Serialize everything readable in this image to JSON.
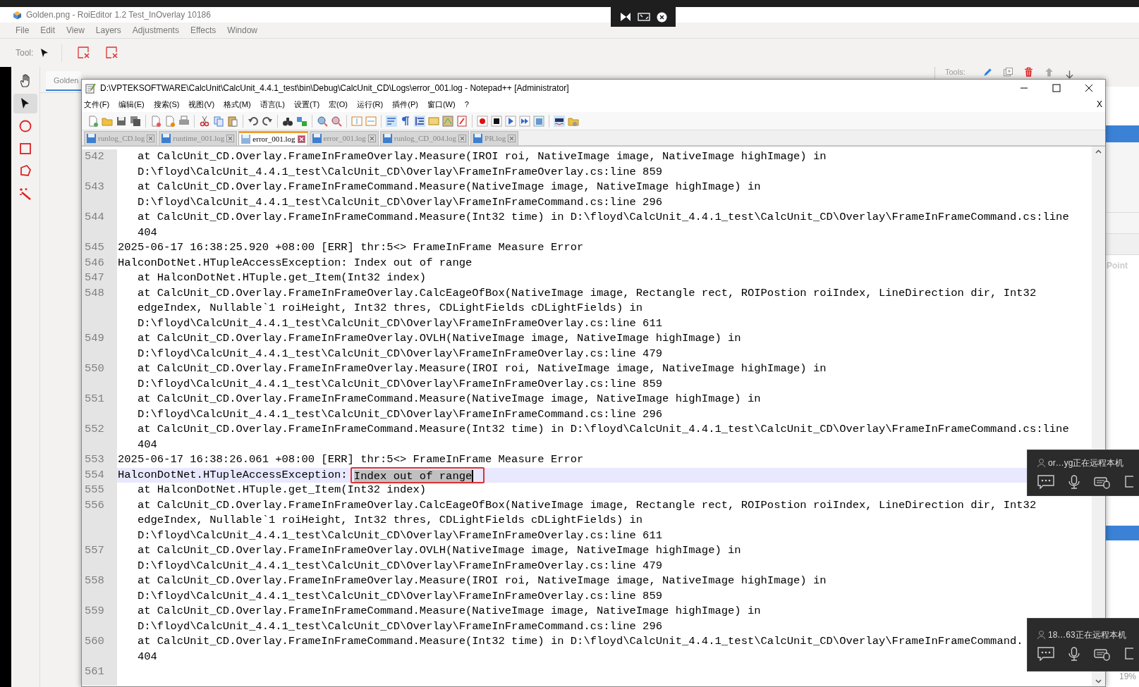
{
  "app": {
    "title": "Golden.png - RoiEditor 1.2 Test_InOverlay 10186",
    "menu": [
      "File",
      "Edit",
      "View",
      "Layers",
      "Adjustments",
      "Effects",
      "Window"
    ],
    "tool_label": "Tool:",
    "tools": [
      {
        "kind": "hand",
        "selected": false
      },
      {
        "kind": "arrow",
        "selected": true
      },
      {
        "kind": "circle",
        "selected": false
      },
      {
        "kind": "rectangle",
        "selected": false
      },
      {
        "kind": "polygon",
        "selected": false
      },
      {
        "kind": "wand",
        "selected": false
      }
    ],
    "document_tab": "Golden",
    "tools_label": "Tools:",
    "point_label": "Point",
    "zoom": "19%"
  },
  "notepad": {
    "title": "D:\\VPTEKSOFTWARE\\CalcUnit\\CalcUnit_4.4.1_test\\bin\\Debug\\CalcUnit_CD\\Logs\\error_001.log - Notepad++ [Administrator]",
    "menu": [
      "文件(F)",
      "编辑(E)",
      "搜索(S)",
      "视图(V)",
      "格式(M)",
      "语言(L)",
      "设置(T)",
      "宏(O)",
      "运行(R)",
      "插件(P)",
      "窗口(W)",
      "?"
    ],
    "close_label": "X",
    "tabs": [
      {
        "label": "runlog_CD.log",
        "selected": false
      },
      {
        "label": "runtime_001.log",
        "selected": false
      },
      {
        "label": "error_001.log",
        "selected": true
      },
      {
        "label": "error_001.log",
        "selected": false
      },
      {
        "label": "runlog_CD_004.log",
        "selected": false
      },
      {
        "label": "PR.log",
        "selected": false
      }
    ],
    "lines": [
      {
        "number": "542",
        "current": false,
        "rows": [
          "   at CalcUnit_CD.Overlay.FrameInFrameOverlay.Measure(IROI roi, NativeImage image, NativeImage highImage) in",
          "   D:\\floyd\\CalcUnit_4.4.1_test\\CalcUnit_CD\\Overlay\\FrameInFrameOverlay.cs:line 859"
        ]
      },
      {
        "number": "543",
        "current": false,
        "rows": [
          "   at CalcUnit_CD.Overlay.FrameInFrameCommand.Measure(NativeImage image, NativeImage highImage) in",
          "   D:\\floyd\\CalcUnit_4.4.1_test\\CalcUnit_CD\\Overlay\\FrameInFrameCommand.cs:line 296"
        ]
      },
      {
        "number": "544",
        "current": false,
        "rows": [
          "   at CalcUnit_CD.Overlay.FrameInFrameCommand.Measure(Int32 time) in D:\\floyd\\CalcUnit_4.4.1_test\\CalcUnit_CD\\Overlay\\FrameInFrameCommand.cs:line",
          "   404"
        ]
      },
      {
        "number": "545",
        "current": false,
        "rows": [
          "2025-06-17 16:38:25.920 +08:00 [ERR] thr:5<> FrameInFrame Measure Error"
        ]
      },
      {
        "number": "546",
        "current": false,
        "rows": [
          "HalconDotNet.HTupleAccessException: Index out of range"
        ]
      },
      {
        "number": "547",
        "current": false,
        "rows": [
          "   at HalconDotNet.HTuple.get_Item(Int32 index)"
        ]
      },
      {
        "number": "548",
        "current": false,
        "rows": [
          "   at CalcUnit_CD.Overlay.FrameInFrameOverlay.CalcEageOfBox(NativeImage image, Rectangle rect, ROIPostion roiIndex, LineDirection dir, Int32",
          "   edgeIndex, Nullable`1 roiHeight, Int32 thres, CDLightFields cDLightFields) in",
          "   D:\\floyd\\CalcUnit_4.4.1_test\\CalcUnit_CD\\Overlay\\FrameInFrameOverlay.cs:line 611"
        ]
      },
      {
        "number": "549",
        "current": false,
        "rows": [
          "   at CalcUnit_CD.Overlay.FrameInFrameOverlay.OVLH(NativeImage image, NativeImage highImage) in",
          "   D:\\floyd\\CalcUnit_4.4.1_test\\CalcUnit_CD\\Overlay\\FrameInFrameOverlay.cs:line 479"
        ]
      },
      {
        "number": "550",
        "current": false,
        "rows": [
          "   at CalcUnit_CD.Overlay.FrameInFrameOverlay.Measure(IROI roi, NativeImage image, NativeImage highImage) in",
          "   D:\\floyd\\CalcUnit_4.4.1_test\\CalcUnit_CD\\Overlay\\FrameInFrameOverlay.cs:line 859"
        ]
      },
      {
        "number": "551",
        "current": false,
        "rows": [
          "   at CalcUnit_CD.Overlay.FrameInFrameCommand.Measure(NativeImage image, NativeImage highImage) in",
          "   D:\\floyd\\CalcUnit_4.4.1_test\\CalcUnit_CD\\Overlay\\FrameInFrameCommand.cs:line 296"
        ]
      },
      {
        "number": "552",
        "current": false,
        "rows": [
          "   at CalcUnit_CD.Overlay.FrameInFrameCommand.Measure(Int32 time) in D:\\floyd\\CalcUnit_4.4.1_test\\CalcUnit_CD\\Overlay\\FrameInFrameCommand.cs:line",
          "   404"
        ]
      },
      {
        "number": "553",
        "current": false,
        "rows": [
          "2025-06-17 16:38:26.061 +08:00 [ERR] thr:5<> FrameInFrame Measure Error"
        ]
      },
      {
        "number": "554",
        "current": true,
        "rows": [
          "HalconDotNet.HTupleAccessException: "
        ],
        "selection": "Index out of range"
      },
      {
        "number": "555",
        "current": false,
        "rows": [
          "   at HalconDotNet.HTuple.get_Item(Int32 index)"
        ]
      },
      {
        "number": "556",
        "current": false,
        "rows": [
          "   at CalcUnit_CD.Overlay.FrameInFrameOverlay.CalcEageOfBox(NativeImage image, Rectangle rect, ROIPostion roiIndex, LineDirection dir, Int32",
          "   edgeIndex, Nullable`1 roiHeight, Int32 thres, CDLightFields cDLightFields) in",
          "   D:\\floyd\\CalcUnit_4.4.1_test\\CalcUnit_CD\\Overlay\\FrameInFrameOverlay.cs:line 611"
        ]
      },
      {
        "number": "557",
        "current": false,
        "rows": [
          "   at CalcUnit_CD.Overlay.FrameInFrameOverlay.OVLH(NativeImage image, NativeImage highImage) in",
          "   D:\\floyd\\CalcUnit_4.4.1_test\\CalcUnit_CD\\Overlay\\FrameInFrameOverlay.cs:line 479"
        ]
      },
      {
        "number": "558",
        "current": false,
        "rows": [
          "   at CalcUnit_CD.Overlay.FrameInFrameOverlay.Measure(IROI roi, NativeImage image, NativeImage highImage) in",
          "   D:\\floyd\\CalcUnit_4.4.1_test\\CalcUnit_CD\\Overlay\\FrameInFrameOverlay.cs:line 859"
        ]
      },
      {
        "number": "559",
        "current": false,
        "rows": [
          "   at CalcUnit_CD.Overlay.FrameInFrameCommand.Measure(NativeImage image, NativeImage highImage) in",
          "   D:\\floyd\\CalcUnit_4.4.1_test\\CalcUnit_CD\\Overlay\\FrameInFrameCommand.cs:line 296"
        ]
      },
      {
        "number": "560",
        "current": false,
        "rows": [
          "   at CalcUnit_CD.Overlay.FrameInFrameCommand.Measure(Int32 time) in D:\\floyd\\CalcUnit_4.4.1_test\\CalcUnit_CD\\Overlay\\FrameInFrameCommand.",
          "   404"
        ]
      },
      {
        "number": "561",
        "current": false
      }
    ]
  },
  "remote_sessions": [
    {
      "label": "or…yg正在远程本机"
    },
    {
      "label": "18…63正在远程本机"
    }
  ]
}
